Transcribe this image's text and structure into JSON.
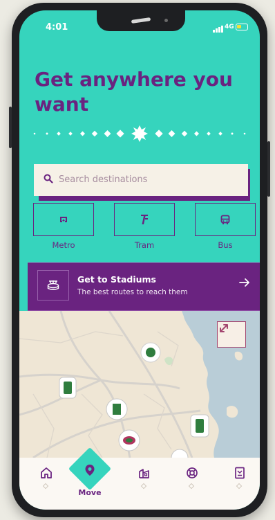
{
  "status_bar": {
    "time": "4:01",
    "network": "4G"
  },
  "hero": {
    "title": "Get anywhere you want"
  },
  "search": {
    "placeholder": "Search destinations"
  },
  "modes": [
    {
      "label": "Metro",
      "icon": "metro-icon"
    },
    {
      "label": "Tram",
      "icon": "tram-icon"
    },
    {
      "label": "Bus",
      "icon": "bus-icon"
    }
  ],
  "stadiums_card": {
    "title": "Get to Stadiums",
    "subtitle": "The best routes to reach them",
    "icon": "stadium-icon",
    "arrow": "arrow-right-icon"
  },
  "map": {
    "expand_icon": "expand-icon",
    "markers": "stadium-marker"
  },
  "bottom_nav": {
    "items": [
      {
        "icon": "home-icon"
      },
      {
        "icon": "location-pin-icon",
        "label": "Move",
        "active": true
      },
      {
        "icon": "building-icon"
      },
      {
        "icon": "lifebuoy-icon"
      },
      {
        "icon": "ticket-icon"
      }
    ]
  },
  "colors": {
    "teal": "#36d4bd",
    "purple": "#6a2380",
    "cream": "#f6f1e7"
  }
}
